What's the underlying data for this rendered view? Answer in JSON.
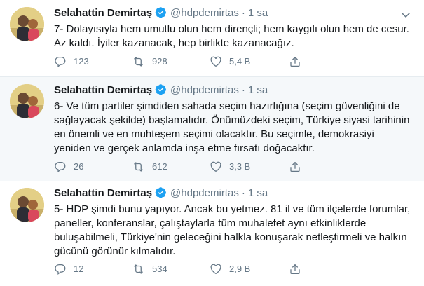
{
  "author": {
    "name": "Selahattin Demirtaş",
    "handle": "@hdpdemirtas",
    "separator": "·",
    "time": "1 sa"
  },
  "tweets": [
    {
      "text": "7- Dolayısıyla hem umutlu olun hem dirençli; hem kaygılı olun hem de cesur. Az kaldı. İyiler kazanacak, hep birlikte kazanacağız.",
      "replies": "123",
      "retweets": "928",
      "likes": "5,4 B"
    },
    {
      "text": "6- Ve tüm partiler şimdiden sahada seçim hazırlığına (seçim güvenliğini de sağlayacak şekilde) başlamalıdır. Önümüzdeki seçim, Türkiye siyasi tarihinin en önemli ve en muhteşem seçimi olacaktır. Bu seçimle, demokrasiyi yeniden ve gerçek anlamda inşa etme fırsatı doğacaktır.",
      "replies": "26",
      "retweets": "612",
      "likes": "3,3 B"
    },
    {
      "text": "5- HDP şimdi bunu yapıyor. Ancak bu yetmez. 81 il ve tüm ilçelerde forumlar, paneller, konferanslar, çalıştaylarla tüm muhalefet aynı etkinliklerde buluşabilmeli, Türkiye'nin geleceğini halkla konuşarak netleştirmeli ve halkın gücünü görünür kılmalıdır.",
      "replies": "12",
      "retweets": "534",
      "likes": "2,9 B"
    }
  ],
  "colors": {
    "verified": "#1da1f2",
    "secondary_text": "#657786",
    "highlight_bg": "#f5f8fa",
    "divider": "#e6ecf0"
  },
  "icons": [
    "verified-badge-icon",
    "caret-down-icon",
    "reply-icon",
    "retweet-icon",
    "like-icon",
    "share-icon"
  ]
}
